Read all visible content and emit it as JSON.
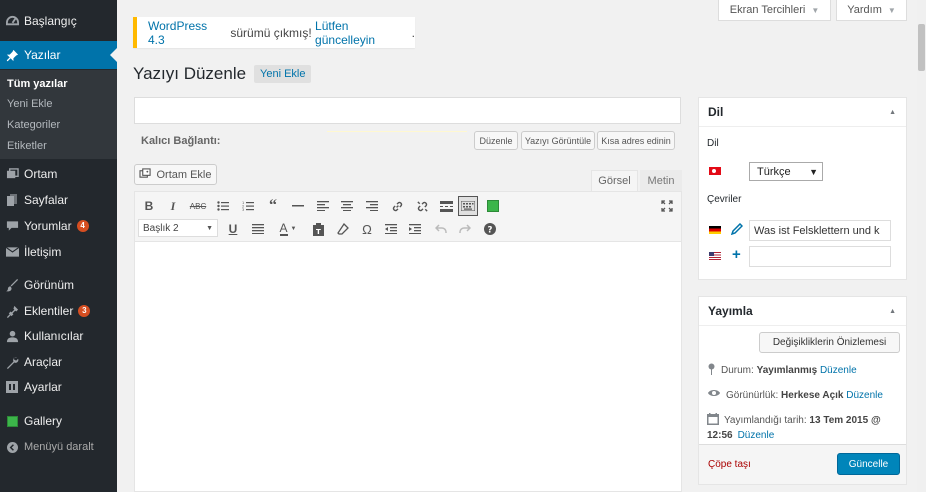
{
  "sidebar": {
    "items": [
      {
        "label": "Başlangıç",
        "icon": "dashboard-icon"
      },
      {
        "label": "Yazılar",
        "icon": "pin-icon"
      },
      {
        "label": "Ortam",
        "icon": "media-icon"
      },
      {
        "label": "Sayfalar",
        "icon": "pages-icon"
      },
      {
        "label": "Yorumlar",
        "icon": "comments-icon",
        "badge": "4"
      },
      {
        "label": "İletişim",
        "icon": "mail-icon"
      },
      {
        "label": "Görünüm",
        "icon": "brush-icon"
      },
      {
        "label": "Eklentiler",
        "icon": "plugin-icon",
        "badge": "3"
      },
      {
        "label": "Kullanıcılar",
        "icon": "users-icon"
      },
      {
        "label": "Araçlar",
        "icon": "wrench-icon"
      },
      {
        "label": "Ayarlar",
        "icon": "settings-icon"
      },
      {
        "label": "Gallery",
        "icon": "gallery-icon"
      },
      {
        "label": "Menüyü daralt",
        "icon": "collapse-icon"
      }
    ],
    "submenu": [
      "Tüm yazılar",
      "Yeni Ekle",
      "Kategoriler",
      "Etiketler"
    ]
  },
  "screen_options": {
    "label": "Ekran Tercihleri"
  },
  "help": {
    "label": "Yardım"
  },
  "notice": {
    "link1": "WordPress 4.3",
    "text": " sürümü çıkmış! ",
    "link2": "Lütfen güncelleyin",
    "end": "."
  },
  "page": {
    "title": "Yazıyı Düzenle",
    "add_new": "Yeni Ekle"
  },
  "permalink": {
    "label": "Kalıcı Bağlantı:",
    "edit": "Düzenle",
    "view": "Yazıyı Görüntüle",
    "shortlink": "Kısa adres edinin"
  },
  "editor": {
    "add_media": "Ortam Ekle",
    "tab_visual": "Görsel",
    "tab_text": "Metin",
    "format": "Başlık 2",
    "toolbar_row1": [
      "bold-icon",
      "italic-icon",
      "strikethrough-icon",
      "bullet-list-icon",
      "numbered-list-icon",
      "blockquote-icon",
      "horizontal-rule-icon",
      "align-left-icon",
      "align-center-icon",
      "align-right-icon",
      "link-icon",
      "unlink-icon",
      "read-more-icon",
      "toolbar-toggle-icon",
      "green-square-icon",
      "fullscreen-icon"
    ],
    "toolbar_row2": [
      "underline-icon",
      "justify-icon",
      "text-color-icon",
      "paste-text-icon",
      "clear-format-icon",
      "special-char-icon",
      "outdent-icon",
      "indent-icon",
      "undo-icon",
      "redo-icon",
      "help-icon"
    ]
  },
  "language_box": {
    "title": "Dil",
    "lang_label": "Dil",
    "selected": "Türkçe",
    "translations_label": "Çevriler",
    "de_value": "Was ist Felsklettern und k",
    "us_value": ""
  },
  "publish_box": {
    "title": "Yayımla",
    "preview": "Değişikliklerin Önizlemesi",
    "status_label": "Durum:",
    "status_value": "Yayımlanmış",
    "status_edit": "Düzenle",
    "visibility_label": "Görünürlük:",
    "visibility_value": "Herkese Açık",
    "visibility_edit": "Düzenle",
    "date_label": "Yayımlandığı tarih:",
    "date_value": "13 Tem 2015 @",
    "time_value": "12:56",
    "date_edit": "Düzenle",
    "trash": "Çöpe taşı",
    "update": "Güncelle"
  },
  "colors": {
    "accent": "#0073aa",
    "sidebar": "#23282d",
    "notice": "#ffb900",
    "update": "#0085ba",
    "badge": "#d54e21"
  }
}
